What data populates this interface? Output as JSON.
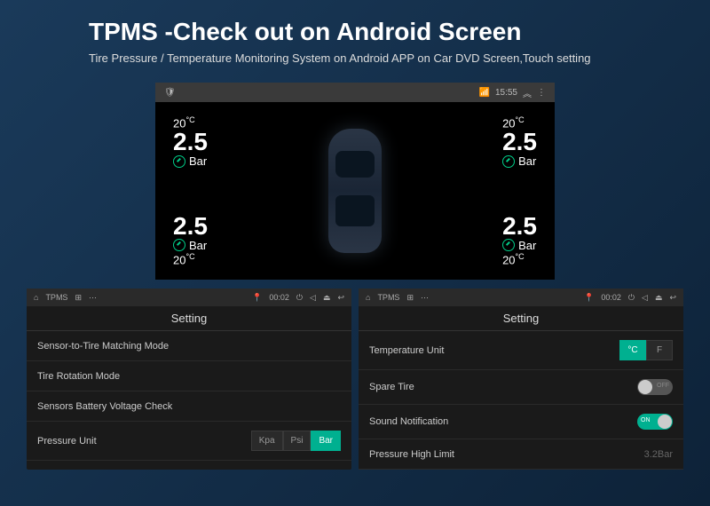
{
  "header": {
    "title": "TPMS -Check out on Android Screen",
    "subtitle": "Tire Pressure / Temperature Monitoring System on Android APP on Car DVD Screen,Touch setting"
  },
  "main_statusbar": {
    "time": "15:55"
  },
  "tires": {
    "front_left": {
      "temp": "20",
      "temp_unit": "°C",
      "pressure": "2.5",
      "unit": "Bar"
    },
    "front_right": {
      "temp": "20",
      "temp_unit": "°C",
      "pressure": "2.5",
      "unit": "Bar"
    },
    "rear_left": {
      "temp": "20",
      "temp_unit": "°C",
      "pressure": "2.5",
      "unit": "Bar"
    },
    "rear_right": {
      "temp": "20",
      "temp_unit": "°C",
      "pressure": "2.5",
      "unit": "Bar"
    }
  },
  "panel_statusbar": {
    "app": "TPMS",
    "time": "00:02"
  },
  "left_panel": {
    "title": "Setting",
    "rows": {
      "r1": "Sensor-to-Tire Matching Mode",
      "r2": "Tire Rotation Mode",
      "r3": "Sensors Battery Voltage Check",
      "r4": "Pressure Unit"
    },
    "pressure_units": {
      "kpa": "Kpa",
      "psi": "Psi",
      "bar": "Bar"
    }
  },
  "right_panel": {
    "title": "Setting",
    "rows": {
      "r1": "Temperature Unit",
      "r2": "Spare Tire",
      "r3": "Sound Notification",
      "r4": "Pressure High Limit"
    },
    "temp_units": {
      "c": "°C",
      "f": "F"
    },
    "toggles": {
      "off": "OFF",
      "on": "ON"
    },
    "pressure_high": "3.2Bar"
  }
}
